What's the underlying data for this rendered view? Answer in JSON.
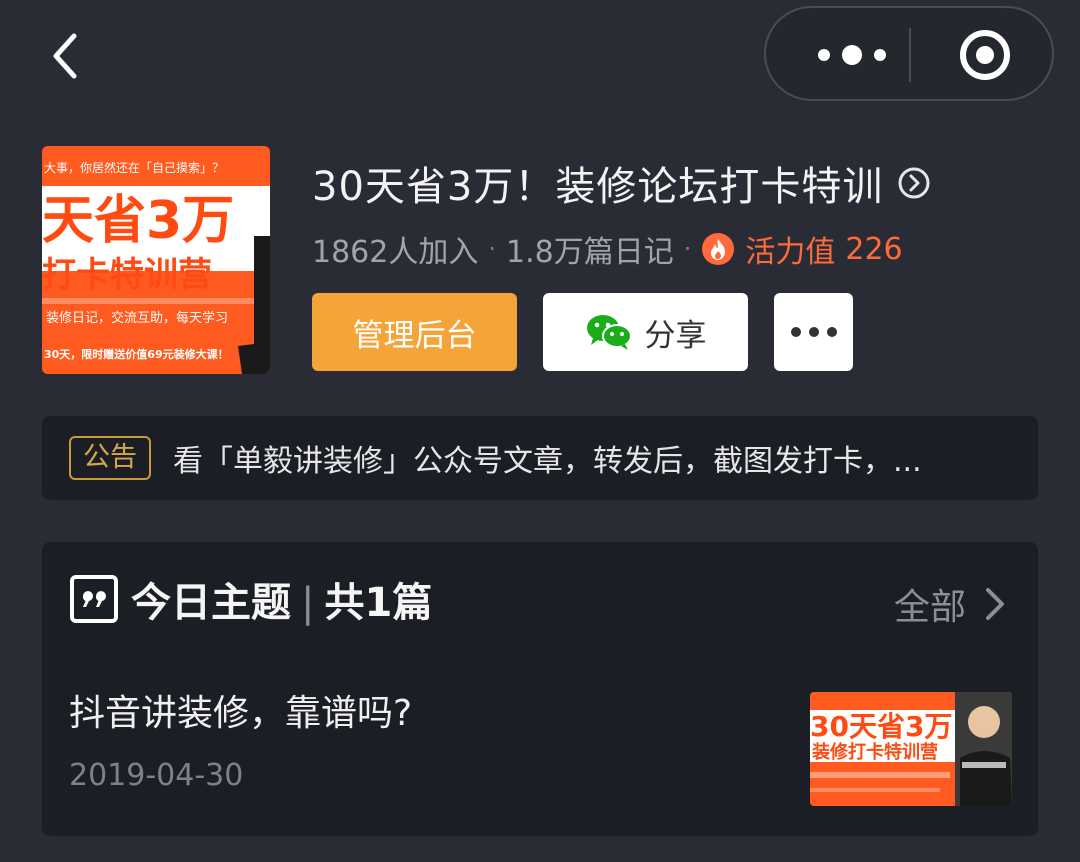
{
  "nav": {
    "back_icon": "chevron-left-icon",
    "more_icon": "more-dots-icon",
    "close_icon": "target-circle-icon"
  },
  "group": {
    "title": "30天省3万！装修论坛打卡特训",
    "members": "1862人加入",
    "separator": "·",
    "diaries": "1.8万篇日记",
    "vitality_label": "活力值",
    "vitality_value": "226",
    "cover": {
      "line1": "大事，你居然还在「自己摸索」？",
      "headline1": "天省3万",
      "headline2": "打卡特训营",
      "line2": "装修日记，交流互助，每天学习",
      "line3": "30天，限时赠送价值69元装修大课！"
    }
  },
  "actions": {
    "admin_label": "管理后台",
    "share_label": "分享",
    "more_icon": "more-dots-icon"
  },
  "notice": {
    "badge": "公告",
    "text": "看「单毅讲装修」公众号文章，转发后，截图发打卡，..."
  },
  "topic": {
    "title": "今日主题",
    "bar": "|",
    "count": "共1篇",
    "all_label": "全部",
    "post": {
      "title": "抖音讲装修，靠谱吗?",
      "date": "2019-04-30",
      "thumb_headline1": "30天省3万",
      "thumb_headline2": "装修打卡特训营"
    }
  },
  "colors": {
    "background": "#2a2c35",
    "card": "#1c1e26",
    "accent_orange": "#f5a43a",
    "vitality": "#ff6a3d",
    "notice_gold": "#d4a848",
    "cover_orange": "#ff5a1f"
  }
}
